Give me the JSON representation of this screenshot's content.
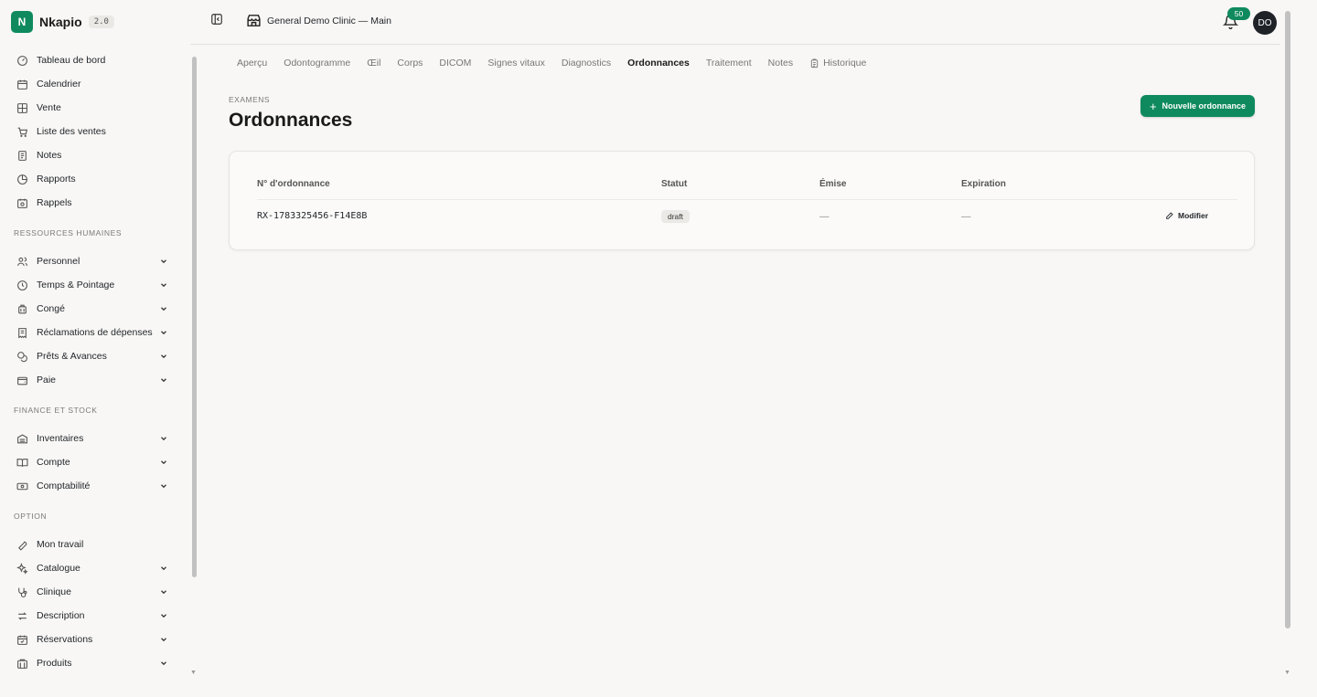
{
  "app": {
    "name": "Nkapio",
    "version": "2.0",
    "logo_letter": "N",
    "accent": "#0f8a5f"
  },
  "topbar": {
    "clinic_name": "General Demo Clinic — Main",
    "notifications_count": "50",
    "avatar_initials": "DO"
  },
  "sidebar": {
    "main_items": [
      {
        "label": "Tableau de bord",
        "icon": "dashboard-icon"
      },
      {
        "label": "Calendrier",
        "icon": "calendar-icon"
      },
      {
        "label": "Vente",
        "icon": "grid-icon"
      },
      {
        "label": "Liste des ventes",
        "icon": "cart-icon"
      },
      {
        "label": "Notes",
        "icon": "note-icon"
      },
      {
        "label": "Rapports",
        "icon": "pie-chart-icon"
      },
      {
        "label": "Rappels",
        "icon": "calendar-clock-icon"
      }
    ],
    "section_hr": "RESSOURCES HUMAINES",
    "hr_items": [
      {
        "label": "Personnel",
        "icon": "users-icon"
      },
      {
        "label": "Temps & Pointage",
        "icon": "clock-icon"
      },
      {
        "label": "Congé",
        "icon": "luggage-icon"
      },
      {
        "label": "Réclamations de dépenses",
        "icon": "receipt-icon"
      },
      {
        "label": "Prêts & Avances",
        "icon": "coins-icon"
      },
      {
        "label": "Paie",
        "icon": "wallet-icon"
      }
    ],
    "section_finance": "FINANCE ET STOCK",
    "finance_items": [
      {
        "label": "Inventaires",
        "icon": "warehouse-icon"
      },
      {
        "label": "Compte",
        "icon": "book-icon"
      },
      {
        "label": "Comptabilité",
        "icon": "banknote-icon"
      }
    ],
    "section_option": "OPTION",
    "option_items": [
      {
        "label": "Mon travail",
        "icon": "wrench-icon"
      },
      {
        "label": "Catalogue",
        "icon": "sparkles-icon"
      },
      {
        "label": "Clinique",
        "icon": "stethoscope-icon"
      },
      {
        "label": "Description",
        "icon": "arrows-icon"
      },
      {
        "label": "Réservations",
        "icon": "calendar-check-icon"
      },
      {
        "label": "Produits",
        "icon": "box-icon"
      }
    ]
  },
  "tabs": [
    {
      "label": "Aperçu"
    },
    {
      "label": "Odontogramme"
    },
    {
      "label": "Œil"
    },
    {
      "label": "Corps"
    },
    {
      "label": "DICOM"
    },
    {
      "label": "Signes vitaux"
    },
    {
      "label": "Diagnostics"
    },
    {
      "label": "Ordonnances",
      "active": true
    },
    {
      "label": "Traitement"
    },
    {
      "label": "Notes"
    },
    {
      "label": "Historique",
      "icon": "clipboard-icon"
    }
  ],
  "page": {
    "eyebrow": "EXAMENS",
    "title": "Ordonnances",
    "new_button": "Nouvelle ordonnance"
  },
  "table": {
    "headers": {
      "number": "N° d'ordonnance",
      "status": "Statut",
      "issued": "Émise",
      "expiration": "Expiration"
    },
    "rows": [
      {
        "number": "RX-1783325456-F14E8B",
        "status": "draft",
        "issued": "—",
        "expiration": "—",
        "action": "Modifier"
      }
    ]
  }
}
